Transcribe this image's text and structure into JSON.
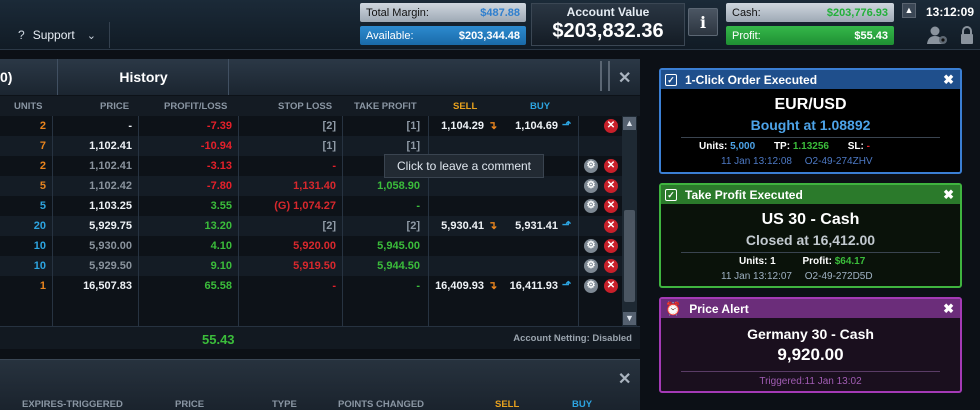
{
  "topbar": {
    "support_label": "Support",
    "total_margin_label": "Total Margin:",
    "total_margin_value": "$487.88",
    "available_label": "Available:",
    "available_value": "$203,344.48",
    "account_value_label": "Account Value",
    "account_value": "$203,832.36",
    "info_label": "i",
    "cash_label": "Cash:",
    "cash_value": "$203,776.93",
    "profit_label": "Profit:",
    "profit_value": "$55.43",
    "clock": "13:12:09"
  },
  "positions": {
    "tab_partial": "0)",
    "tab_history": "History",
    "columns": [
      "UNITS",
      "PRICE",
      "PROFIT/LOSS",
      "STOP LOSS",
      "TAKE PROFIT",
      "SELL",
      "BUY"
    ],
    "rows": [
      {
        "units": "2",
        "price": "-",
        "pl": "-7.39",
        "sl": "[2]",
        "tp": "[1]",
        "sell": "1,104.29",
        "buy": "1,104.69",
        "units_color": "org",
        "actions": "x"
      },
      {
        "units": "7",
        "price": "1,102.41",
        "pl": "-10.94",
        "sl": "[1]",
        "tp": "[1]",
        "sell": "",
        "buy": "",
        "units_color": "org",
        "actions": ""
      },
      {
        "units": "2",
        "price": "1,102.41",
        "pl": "-3.13",
        "sl": "-",
        "tp": "",
        "sell": "",
        "buy": "",
        "units_color": "org",
        "actions": "gx"
      },
      {
        "units": "5",
        "price": "1,102.42",
        "pl": "-7.80",
        "sl": "1,131.40",
        "tp": "1,058.90",
        "sell": "",
        "buy": "",
        "units_color": "org",
        "actions": "gx"
      },
      {
        "units": "5",
        "price": "1,103.25",
        "pl": "3.55",
        "sl": "(G) 1,074.27",
        "tp": "-",
        "sell": "",
        "buy": "",
        "units_color": "blu",
        "actions": "gx"
      },
      {
        "units": "20",
        "price": "5,929.75",
        "pl": "13.20",
        "sl": "[2]",
        "tp": "[2]",
        "sell": "5,930.41",
        "buy": "5,931.41",
        "units_color": "blu",
        "actions": "x"
      },
      {
        "units": "10",
        "price": "5,930.00",
        "pl": "4.10",
        "sl": "5,920.00",
        "tp": "5,945.00",
        "sell": "",
        "buy": "",
        "units_color": "blu",
        "actions": "gx"
      },
      {
        "units": "10",
        "price": "5,929.50",
        "pl": "9.10",
        "sl": "5,919.50",
        "tp": "5,944.50",
        "sell": "",
        "buy": "",
        "units_color": "blu",
        "actions": "gx"
      },
      {
        "units": "1",
        "price": "16,507.83",
        "pl": "65.58",
        "sl": "-",
        "tp": "-",
        "sell": "16,409.93",
        "buy": "16,411.93",
        "units_color": "org",
        "actions": "gx"
      }
    ],
    "tooltip": "Click to leave a comment",
    "total_pl": "55.43",
    "netting": "Account Netting: Disabled"
  },
  "orders": {
    "columns": [
      "EXPIRES-TRIGGERED",
      "PRICE",
      "TYPE",
      "POINTS CHANGED",
      "SELL",
      "BUY"
    ]
  },
  "notifications": [
    {
      "title": "1-Click Order Executed",
      "market": "EUR/USD",
      "detail": "Bought at 1.08892",
      "units_label": "Units:",
      "units": "5,000",
      "tp_label": "TP:",
      "tp": "1.13256",
      "sl_label": "SL:",
      "sl": "-",
      "time": "11 Jan 13:12:08",
      "ref": "O2-49-274ZHV"
    },
    {
      "title": "Take Profit Executed",
      "market": "US 30 - Cash",
      "detail": "Closed at 16,412.00",
      "units_label": "Units:",
      "units": "1",
      "profit_label": "Profit:",
      "profit": "$64.17",
      "time": "11 Jan 13:12:07",
      "ref": "O2-49-272D5D"
    },
    {
      "title": "Price Alert",
      "market": "Germany 30 - Cash",
      "price": "9,920.00",
      "triggered": "Triggered:11 Jan 13:02"
    }
  ]
}
